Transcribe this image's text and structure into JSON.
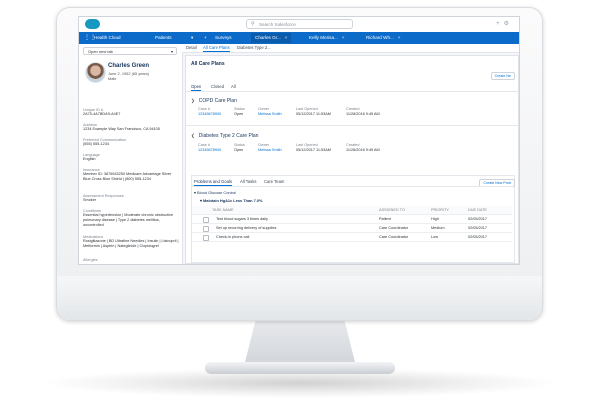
{
  "header": {
    "search_placeholder": "Search Salesforce",
    "icons": [
      "plus-icon",
      "gear-icon"
    ]
  },
  "nav": {
    "app_name": "Health Cloud",
    "object": "Patients",
    "tabs": [
      {
        "label": "Surveys"
      },
      {
        "label": "Charles Gr..."
      },
      {
        "label": "Kelly Morisa..."
      },
      {
        "label": "Richard Wh..."
      }
    ]
  },
  "left": {
    "open_new_tab": "Open new tab",
    "patient": {
      "name": "Charles Green",
      "dob": "June 2, 1952 (65 years)",
      "sex": "Male"
    },
    "fields": [
      {
        "label": "Unique ID #",
        "value": "2A75-4A7BDA9-A4E7"
      },
      {
        "label": "Address",
        "value": "1234 Example Way San Francisco, CA 94105"
      },
      {
        "label": "Preferred Communication",
        "value": "(555) 555-1234"
      },
      {
        "label": "Language",
        "value": "English"
      },
      {
        "label": "Insurance",
        "value": "Member ID: 3876543250 Medicare Advantage Silver Blue Cross Blue Shield | (800) 555-1234"
      },
      {
        "label": "Assessment Responses",
        "value": "Smoker"
      },
      {
        "label": "Conditions",
        "value": "Essential hypertension | Moderate chronic obstructive pulmonary disease | Type 2 diabetes mellitus, uncontrolled"
      },
      {
        "label": "Medications",
        "value": "Rosiglitazone | BD Ultrafine Needles | Insulin | Lisinopril | Metformin | Aspirin | Nateglinide | Clopidogrel"
      },
      {
        "label": "Allergies",
        "value": ""
      }
    ]
  },
  "main": {
    "subtabs": [
      "Detail",
      "All Care Plans",
      "Diabetes Type 2..."
    ],
    "title": "All Care Plans",
    "create_new": "Create Ne",
    "filter_tabs": [
      "Open",
      "Closed",
      "All"
    ],
    "col_headers": [
      "Case #",
      "Status",
      "Owner",
      "Last Opened",
      "Created"
    ],
    "plans": [
      {
        "name": "COPD Care Plan",
        "case": "12345678900",
        "status": "Open",
        "owner": "Melissa Smith",
        "last_opened": "05/12/2017 11:53AM",
        "created": "11/28/2016 9:49 AM"
      },
      {
        "name": "Diabetes Type 2 Care Plan",
        "case": "12345678900",
        "status": "Open",
        "owner": "Melissa Smith",
        "last_opened": "05/12/2017 11:53AM",
        "created": "11/28/2016 9:49 AM"
      }
    ],
    "pg_tabs": [
      "Problems and Goals",
      "All Tasks",
      "Care Team"
    ],
    "create_new_problem": "Create New Prob",
    "problem": "Blood Glucose Control",
    "goal": "Maintain HgA1c Less Than 7.0%",
    "task_headers": [
      "TASK NAME",
      "ASSIGNED TO",
      "PRIORITY",
      "DUE DATE"
    ],
    "tasks": [
      {
        "name": "Test blood sugars 3 times daily",
        "assigned": "Patient",
        "priority": "High",
        "due": "02/05/2017"
      },
      {
        "name": "Set up recurring delivery of supplies",
        "assigned": "Care Coordinator",
        "priority": "Medium",
        "due": "02/05/2017"
      },
      {
        "name": "Check-in phone call",
        "assigned": "Care Coordinator",
        "priority": "Low",
        "due": "02/05/2017"
      }
    ]
  }
}
